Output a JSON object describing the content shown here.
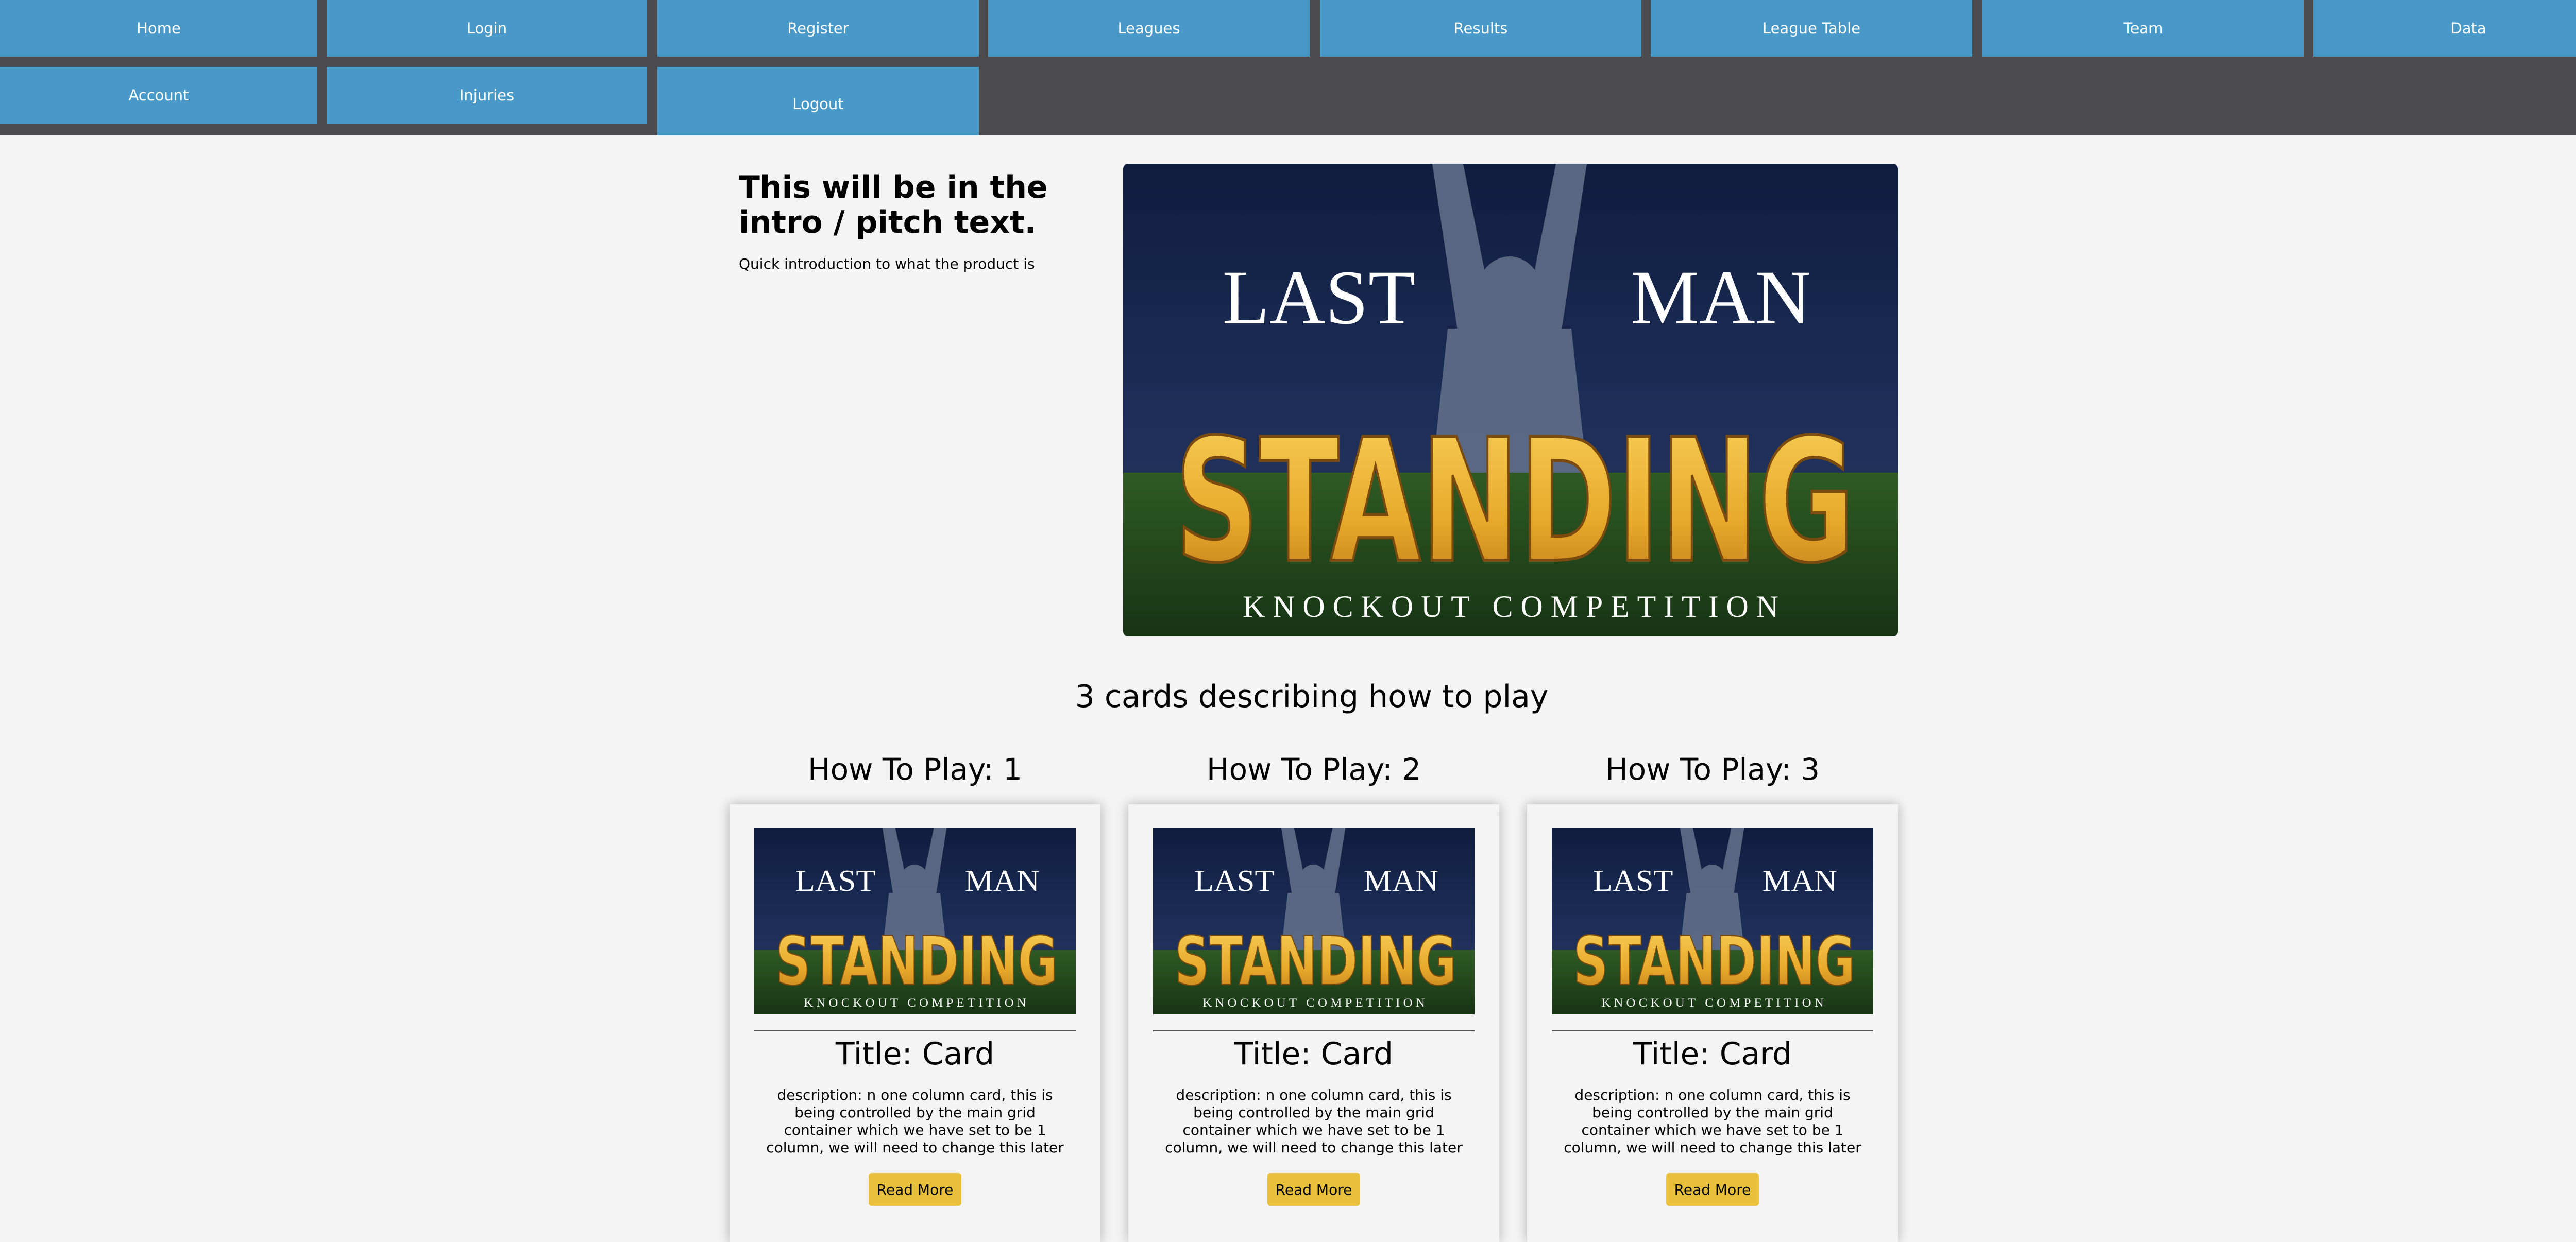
{
  "nav": {
    "items": [
      {
        "label": "Home"
      },
      {
        "label": "Login"
      },
      {
        "label": "Register"
      },
      {
        "label": "Leagues"
      },
      {
        "label": "Results"
      },
      {
        "label": "League Table"
      },
      {
        "label": "Team"
      },
      {
        "label": "Data"
      },
      {
        "label": "Account"
      },
      {
        "label": "Injuries"
      },
      {
        "label": "Logout"
      }
    ]
  },
  "hero": {
    "title": "This will be in the intro / pitch text.",
    "subtitle": "Quick introduction to what the product is",
    "image": {
      "line1_left": "LAST",
      "line1_right": "MAN",
      "line2": "STANDING",
      "line3": "KNOCKOUT COMPETITION"
    }
  },
  "section": {
    "heading": "3 cards describing how to play"
  },
  "cards": [
    {
      "heading": "How To Play: 1",
      "title": "Title: Card",
      "description": "description: n one column card, this is being controlled by the main grid container which we have set to be 1 column, we will need to change this later",
      "button": "Read More"
    },
    {
      "heading": "How To Play: 2",
      "title": "Title: Card",
      "description": "description: n one column card, this is being controlled by the main grid container which we have set to be 1 column, we will need to change this later",
      "button": "Read More"
    },
    {
      "heading": "How To Play: 3",
      "title": "Title: Card",
      "description": "description: n one column card, this is being controlled by the main grid container which we have set to be 1 column, we will need to change this later",
      "button": "Read More"
    }
  ],
  "colors": {
    "nav_bar": "#4b4b4d",
    "nav_button": "#4899c7",
    "page_bg": "#f4f4f4",
    "read_more_button": "#e8c03c",
    "logo_gold": "#e8b430"
  }
}
